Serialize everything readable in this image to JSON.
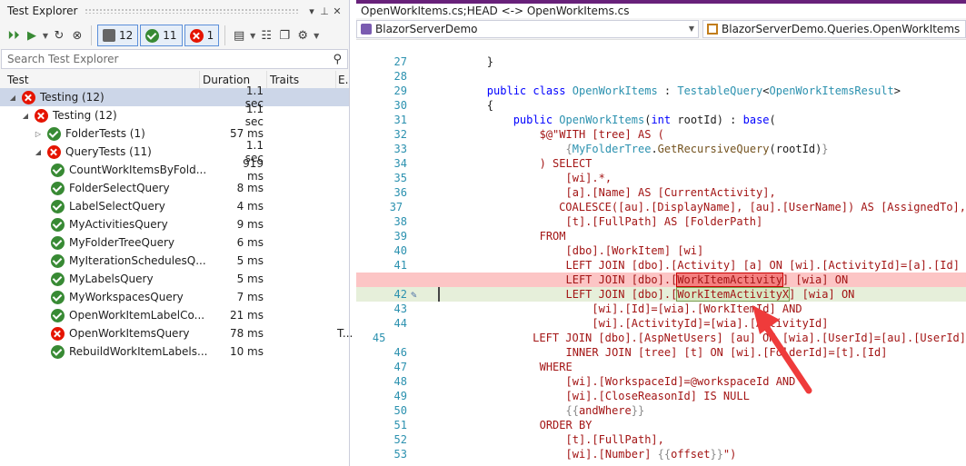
{
  "test_explorer": {
    "title": "Test Explorer",
    "title_controls": [
      "▾",
      "⊥",
      "✕"
    ],
    "toolbar": {
      "total_count": "12",
      "passed_count": "11",
      "failed_count": "1"
    },
    "search_placeholder": "Search Test Explorer",
    "columns": {
      "test": "Test",
      "duration": "Duration",
      "traits": "Traits",
      "error": "E."
    },
    "rows": [
      {
        "label": "Testing (12)",
        "duration": "1.1 sec",
        "status": "fail",
        "level": 0,
        "expand": "open"
      },
      {
        "label": "Testing (12)",
        "duration": "1.1 sec",
        "status": "fail",
        "level": 1,
        "expand": "open"
      },
      {
        "label": "FolderTests (1)",
        "duration": "57 ms",
        "status": "pass",
        "level": 2,
        "expand": "closed"
      },
      {
        "label": "QueryTests (11)",
        "duration": "1.1 sec",
        "status": "fail",
        "level": 2,
        "expand": "open"
      },
      {
        "label": "CountWorkItemsByFold...",
        "duration": "919 ms",
        "status": "pass",
        "level": 3
      },
      {
        "label": "FolderSelectQuery",
        "duration": "8 ms",
        "status": "pass",
        "level": 3
      },
      {
        "label": "LabelSelectQuery",
        "duration": "4 ms",
        "status": "pass",
        "level": 3
      },
      {
        "label": "MyActivitiesQuery",
        "duration": "9 ms",
        "status": "pass",
        "level": 3
      },
      {
        "label": "MyFolderTreeQuery",
        "duration": "6 ms",
        "status": "pass",
        "level": 3
      },
      {
        "label": "MyIterationSchedulesQ...",
        "duration": "5 ms",
        "status": "pass",
        "level": 3
      },
      {
        "label": "MyLabelsQuery",
        "duration": "5 ms",
        "status": "pass",
        "level": 3
      },
      {
        "label": "MyWorkspacesQuery",
        "duration": "7 ms",
        "status": "pass",
        "level": 3
      },
      {
        "label": "OpenWorkItemLabelCo...",
        "duration": "21 ms",
        "status": "pass",
        "level": 3
      },
      {
        "label": "OpenWorkItemsQuery",
        "duration": "78 ms",
        "status": "fail",
        "level": 3,
        "trait": "T..."
      },
      {
        "label": "RebuildWorkItemLabels...",
        "duration": "10 ms",
        "status": "pass",
        "level": 3
      }
    ]
  },
  "editor": {
    "tab_title": "OpenWorkItems.cs;HEAD <-> OpenWorkItems.cs",
    "nav_project": "BlazorServerDemo",
    "nav_class": "BlazorServerDemo.Queries.OpenWorkItems",
    "lines": [
      {
        "n": "27",
        "html": "        }"
      },
      {
        "n": "28",
        "html": ""
      },
      {
        "n": "29",
        "html": "        <span class='k'>public</span> <span class='k'>class</span> <span class='t'>OpenWorkItems</span> : <span class='t'>TestableQuery</span>&lt;<span class='t'>OpenWorkItemsResult</span>&gt;"
      },
      {
        "n": "30",
        "html": "        {"
      },
      {
        "n": "31",
        "html": "            <span class='k'>public</span> <span class='t'>OpenWorkItems</span>(<span class='k'>int</span> rootId) : <span class='k'>base</span>("
      },
      {
        "n": "32",
        "html": "                <span class='s'>$@\"WITH [tree] AS (</span>"
      },
      {
        "n": "33",
        "html": "                    <span class='br'>{</span><span class='t'>MyFolderTree</span>.<span class='f'>GetRecursiveQuery</span>(rootId)<span class='br'>}</span>"
      },
      {
        "n": "34",
        "html": "                <span class='s'>) SELECT</span>"
      },
      {
        "n": "35",
        "html": "                    <span class='s'>[wi].*,</span>"
      },
      {
        "n": "36",
        "html": "                    <span class='s'>[a].[Name] AS [CurrentActivity],</span>"
      },
      {
        "n": "37",
        "html": "                    <span class='s'>COALESCE([au].[DisplayName], [au].[UserName]) AS [AssignedTo],</span>"
      },
      {
        "n": "38",
        "html": "                    <span class='s'>[t].[FullPath] AS [FolderPath]</span>"
      },
      {
        "n": "39",
        "html": "                <span class='s'>FROM</span>"
      },
      {
        "n": "40",
        "html": "                    <span class='s'>[dbo].[WorkItem] [wi]</span>"
      },
      {
        "n": "41",
        "html": "                    <span class='s'>LEFT JOIN [dbo].[Activity] [a] ON [wi].[ActivityId]=[a].[Id]</span>"
      },
      {
        "n": "",
        "kind": "del",
        "html": "                    <span class='s'>LEFT JOIN [dbo].[<span class='hl-del'>WorkItemActivity</span>] [wia] ON</span>"
      },
      {
        "n": "42",
        "kind": "add",
        "html": "                    <span class='s'>LEFT JOIN [dbo].[<span class='hl-add'>WorkItemActivityX</span>] [wia] ON</span>"
      },
      {
        "n": "43",
        "html": "                        <span class='s'>[wi].[Id]=[wia].[WorkItemId] AND</span>"
      },
      {
        "n": "44",
        "html": "                        <span class='s'>[wi].[ActivityId]=[wia].[ActivityId]</span>"
      },
      {
        "n": "45",
        "html": "                    <span class='s'>LEFT JOIN [dbo].[AspNetUsers] [au] ON [wia].[UserId]=[au].[UserId]</span>"
      },
      {
        "n": "46",
        "html": "                    <span class='s'>INNER JOIN [tree] [t] ON [wi].[FolderId]=[t].[Id]</span>"
      },
      {
        "n": "47",
        "html": "                <span class='s'>WHERE</span>"
      },
      {
        "n": "48",
        "html": "                    <span class='s'>[wi].[WorkspaceId]=@workspaceId AND</span>"
      },
      {
        "n": "49",
        "html": "                    <span class='s'>[wi].[CloseReasonId] IS NULL</span>"
      },
      {
        "n": "50",
        "html": "                    <span class='br'>{{</span><span class='s'>andWhere</span><span class='br'>}}</span>"
      },
      {
        "n": "51",
        "html": "                <span class='s'>ORDER BY</span>"
      },
      {
        "n": "52",
        "html": "                    <span class='s'>[t].[FullPath],</span>"
      },
      {
        "n": "53",
        "html": "                    <span class='s'>[wi].[Number] </span><span class='br'>{{</span><span class='s'>offset</span><span class='br'>}}</span><span class='s'>\")</span>"
      }
    ]
  }
}
